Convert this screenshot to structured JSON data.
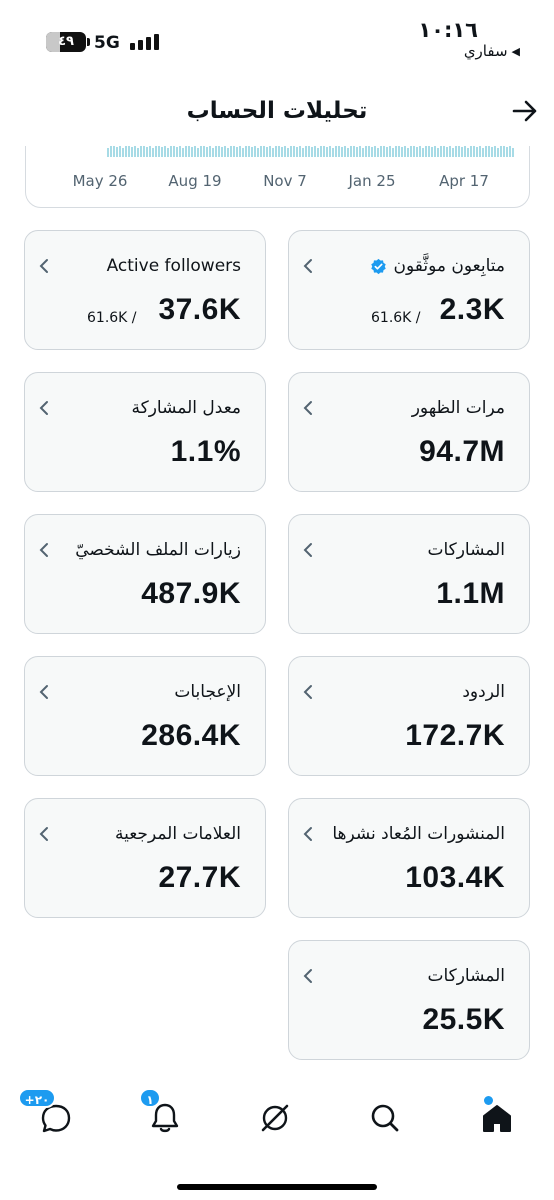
{
  "status_bar": {
    "time": "١٠:١٦",
    "back_app": "سفاري",
    "battery": "٤٩",
    "network": "5G"
  },
  "header": {
    "title": "تحليلات الحساب"
  },
  "chart": {
    "x_labels": [
      "May 26",
      "Aug 19",
      "Nov 7",
      "Jan 25",
      "Apr 17"
    ],
    "bar_color": "#a7dbe6"
  },
  "metrics": {
    "active_followers": {
      "label": "Active followers",
      "value": "37.6K",
      "sub": "61.6K /"
    },
    "verified_followers": {
      "label": "متابِعون موثَّقون",
      "value": "2.3K",
      "sub": "61.6K /"
    },
    "engagement_rate": {
      "label": "معدل المشاركة",
      "value": "1.1%"
    },
    "impressions": {
      "label": "مرات الظهور",
      "value": "94.7M"
    },
    "profile_visits": {
      "label": "زيارات الملف الشخصيّ",
      "value": "487.9K"
    },
    "engagements": {
      "label": "المشاركات",
      "value": "1.1M"
    },
    "likes": {
      "label": "الإعجابات",
      "value": "286.4K"
    },
    "replies": {
      "label": "الردود",
      "value": "172.7K"
    },
    "bookmarks": {
      "label": "العلامات المرجعية",
      "value": "27.7K"
    },
    "reposts": {
      "label": "المنشورات المُعاد نشرها",
      "value": "103.4K"
    },
    "shares": {
      "label": "المشاركات",
      "value": "25.5K"
    }
  },
  "bottom_nav": {
    "messages_badge": "+٢٠",
    "notifications_badge": "١"
  },
  "colors": {
    "accent": "#1d9bf0",
    "card_bg": "#f7f9f9",
    "card_border": "#cfd5da"
  }
}
